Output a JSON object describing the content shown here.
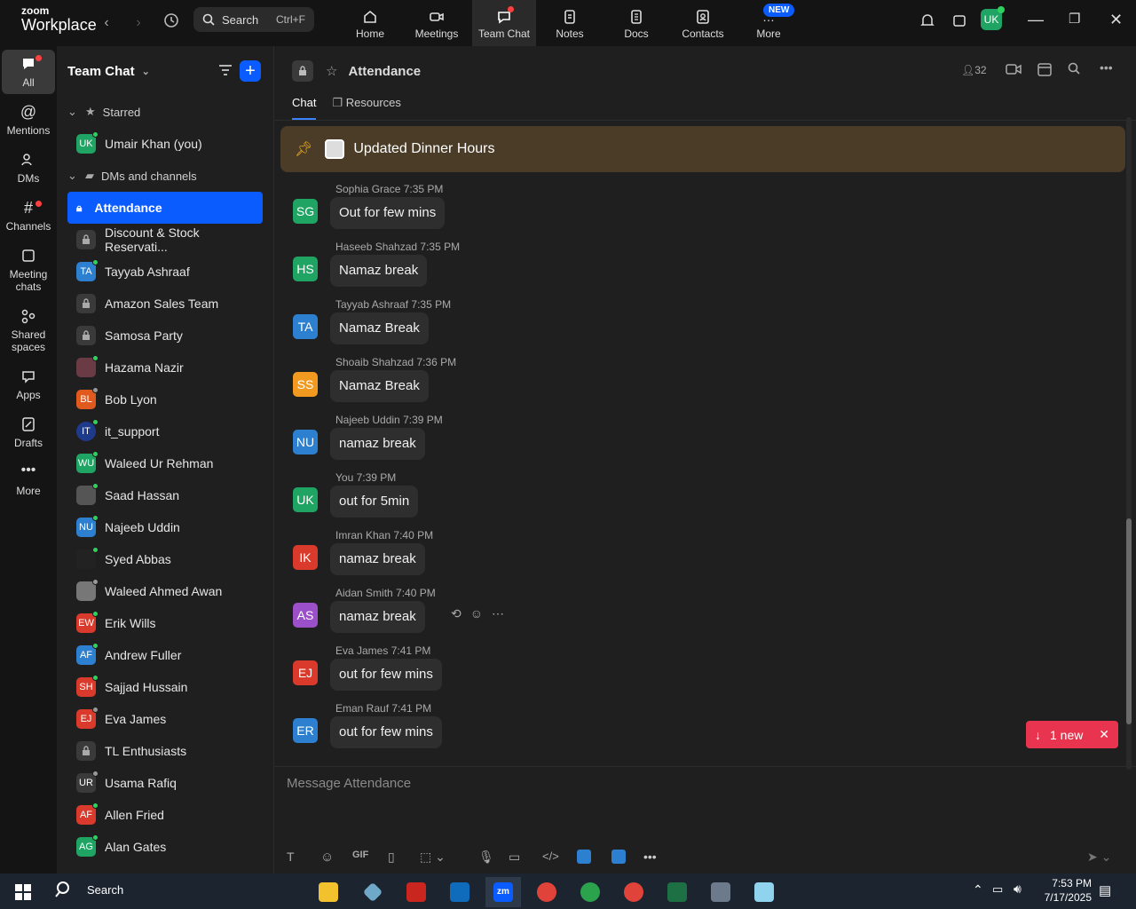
{
  "app": {
    "logo_top": "zoom",
    "logo_bottom": "Workplace"
  },
  "search": {
    "label": "Search",
    "shortcut": "Ctrl+F"
  },
  "top_tabs": [
    {
      "label": "Home"
    },
    {
      "label": "Meetings"
    },
    {
      "label": "Team Chat"
    },
    {
      "label": "Notes"
    },
    {
      "label": "Docs"
    },
    {
      "label": "Contacts"
    },
    {
      "label": "More"
    }
  ],
  "new_badge": "NEW",
  "user_avatar": "UK",
  "rail": [
    {
      "label": "All"
    },
    {
      "label": "Mentions"
    },
    {
      "label": "DMs"
    },
    {
      "label": "Channels"
    },
    {
      "label": "Meeting chats"
    },
    {
      "label": "Shared spaces"
    },
    {
      "label": "Apps"
    },
    {
      "label": "Drafts"
    },
    {
      "label": "More"
    }
  ],
  "sidebar": {
    "title": "Team Chat",
    "starred_label": "Starred",
    "starred_item": "Umair Khan (you)",
    "dms_label": "DMs and channels",
    "items": [
      {
        "label": "Attendance",
        "initials": ""
      },
      {
        "label": "Discount & Stock Reservati...",
        "initials": ""
      },
      {
        "label": "Tayyab Ashraaf",
        "initials": "TA"
      },
      {
        "label": "Amazon Sales Team",
        "initials": ""
      },
      {
        "label": "Samosa Party",
        "initials": ""
      },
      {
        "label": "Hazama Nazir",
        "initials": ""
      },
      {
        "label": "Bob Lyon",
        "initials": "BL"
      },
      {
        "label": "it_support",
        "initials": ""
      },
      {
        "label": "Waleed Ur Rehman",
        "initials": "WU"
      },
      {
        "label": "Saad Hassan",
        "initials": ""
      },
      {
        "label": "Najeeb Uddin",
        "initials": "NU"
      },
      {
        "label": "Syed Abbas",
        "initials": ""
      },
      {
        "label": "Waleed Ahmed Awan",
        "initials": ""
      },
      {
        "label": "Erik Wills",
        "initials": "EW"
      },
      {
        "label": "Andrew Fuller",
        "initials": "AF"
      },
      {
        "label": "Sajjad Hussain",
        "initials": "SH"
      },
      {
        "label": "Eva James",
        "initials": "EJ"
      },
      {
        "label": "TL Enthusiasts",
        "initials": ""
      },
      {
        "label": "Usama Rafiq",
        "initials": "UR"
      },
      {
        "label": "Allen Fried",
        "initials": "AF"
      },
      {
        "label": "Alan Gates",
        "initials": "AG"
      }
    ]
  },
  "channel": {
    "title": "Attendance",
    "member_count": "32",
    "tabs": [
      "Chat",
      "Resources"
    ],
    "pinned": "Updated Dinner Hours"
  },
  "messages": [
    {
      "initials": "SG",
      "name": "Sophia Grace",
      "time": "7:35 PM",
      "text": "Out for few mins",
      "color": "#1fa463"
    },
    {
      "initials": "HS",
      "name": "Haseeb Shahzad",
      "time": "7:35 PM",
      "text": "Namaz break",
      "color": "#1fa463"
    },
    {
      "initials": "TA",
      "name": "Tayyab Ashraaf",
      "time": "7:35 PM",
      "text": "Namaz Break",
      "color": "#2d7fd0"
    },
    {
      "initials": "SS",
      "name": "Shoaib Shahzad",
      "time": "7:36 PM",
      "text": "Namaz Break",
      "color": "#f29a1f"
    },
    {
      "initials": "NU",
      "name": "Najeeb Uddin",
      "time": "7:39 PM",
      "text": "namaz break",
      "color": "#2d7fd0"
    },
    {
      "initials": "UK",
      "name": "You",
      "time": "7:39 PM",
      "text": "out for 5min",
      "color": "#1fa463"
    },
    {
      "initials": "IK",
      "name": "Imran Khan",
      "time": "7:40 PM",
      "text": "namaz break",
      "color": "#d93a2b"
    },
    {
      "initials": "AS",
      "name": "Aidan Smith",
      "time": "7:40 PM",
      "text": "namaz break",
      "color": "#9b4fc9"
    },
    {
      "initials": "EJ",
      "name": "Eva James",
      "time": "7:41 PM",
      "text": "out for few mins",
      "color": "#d93a2b"
    },
    {
      "initials": "ER",
      "name": "Eman Rauf",
      "time": "7:41 PM",
      "text": "out for few mins",
      "color": "#2d7fd0"
    }
  ],
  "new_messages": "1 new",
  "compose": {
    "placeholder": "Message Attendance",
    "gif_label": "GIF"
  },
  "taskbar": {
    "search_label": "Search",
    "time": "7:53 PM",
    "date": "7/17/2025"
  }
}
